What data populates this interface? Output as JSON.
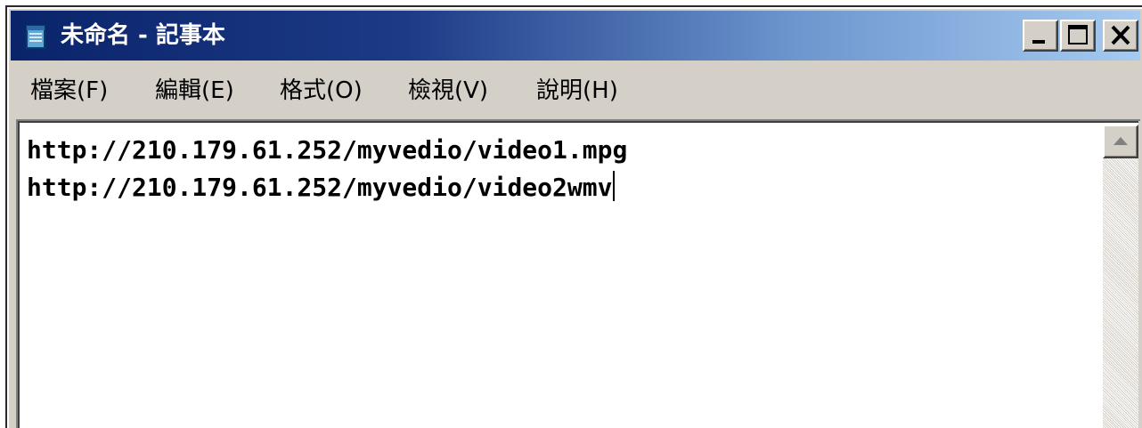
{
  "window": {
    "title": "未命名 - 記事本",
    "icon": "notepad-icon"
  },
  "caption_buttons": {
    "minimize_icon": "minimize-icon",
    "maximize_icon": "maximize-icon",
    "close_icon": "close-icon"
  },
  "menu": {
    "items": [
      {
        "label": "檔案(F)"
      },
      {
        "label": "編輯(E)"
      },
      {
        "label": "格式(O)"
      },
      {
        "label": "檢視(V)"
      },
      {
        "label": "說明(H)"
      }
    ]
  },
  "editor": {
    "lines": [
      "http://210.179.61.252/myvedio/video1.mpg",
      "http://210.179.61.252/myvedio/video2wmv"
    ]
  },
  "scrollbar": {
    "up_icon": "scroll-up-arrow-icon"
  },
  "colors": {
    "title_bar_start": "#0a246a",
    "title_bar_end": "#a6caf0",
    "chrome": "#d4d0c8"
  }
}
